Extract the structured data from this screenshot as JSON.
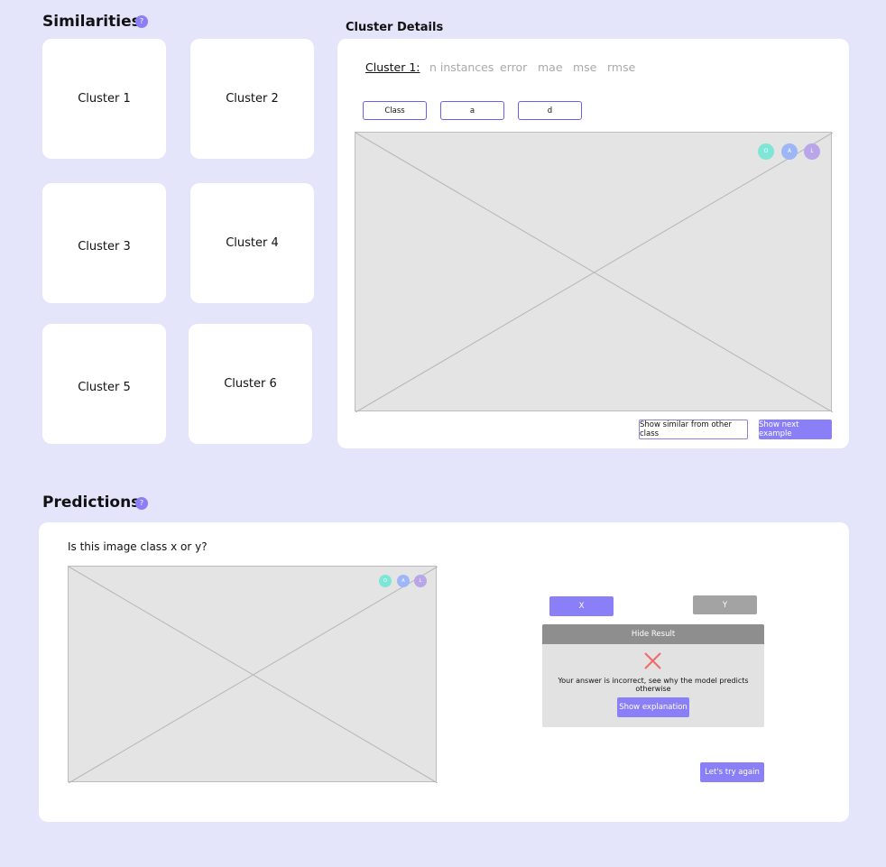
{
  "similarities": {
    "title": "Similarities",
    "help_glyph": "?",
    "clusters": [
      "Cluster 1",
      "Cluster 2",
      "Cluster 3",
      "Cluster 4",
      "Cluster 5",
      "Cluster 6"
    ]
  },
  "cluster_details": {
    "title": "Cluster Details",
    "tabs": [
      "Cluster 1:",
      "n instances",
      "error",
      "mae",
      "mse",
      "rmse"
    ],
    "filters": [
      "Class",
      "a",
      "d"
    ],
    "image_dots": [
      {
        "label": "O",
        "color": "#7ee6d6"
      },
      {
        "label": "A",
        "color": "#9cb6f7"
      },
      {
        "label": "L",
        "color": "#b8a6e8"
      }
    ],
    "show_similar_label": "Show similar from other class",
    "show_next_label": "Show next example"
  },
  "predictions": {
    "title": "Predictions",
    "help_glyph": "?",
    "question": "Is this image class x or y?",
    "image_dots": [
      {
        "label": "O",
        "color": "#7ee6d6"
      },
      {
        "label": "A",
        "color": "#9cb6f7"
      },
      {
        "label": "L",
        "color": "#b8a6e8"
      }
    ],
    "option_x": "X",
    "option_y": "Y",
    "hide_result_label": "Hide Result",
    "result_icon": "cross-icon",
    "result_message": "Your answer is incorrect, see why the model predicts otherwise",
    "show_explanation_label": "Show explanation",
    "try_again_label": "Let's try again"
  },
  "colors": {
    "background": "#e4e5fb",
    "accent": "#8b7ff7",
    "error": "#f06a6a"
  }
}
